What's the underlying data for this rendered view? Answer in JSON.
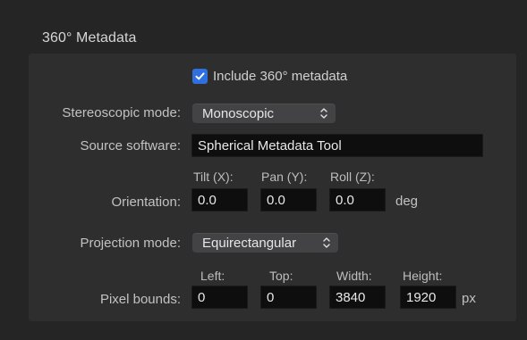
{
  "section": {
    "title": "360° Metadata"
  },
  "include_metadata": {
    "label": "Include 360° metadata",
    "checked": true,
    "color": "#2f6fe0"
  },
  "stereoscopic": {
    "label": "Stereoscopic mode:",
    "value": "Monoscopic"
  },
  "source_software": {
    "label": "Source software:",
    "value": "Spherical Metadata Tool"
  },
  "orientation": {
    "label": "Orientation:",
    "unit": "deg",
    "tilt": {
      "label": "Tilt (X):",
      "value": "0.0"
    },
    "pan": {
      "label": "Pan (Y):",
      "value": "0.0"
    },
    "roll": {
      "label": "Roll (Z):",
      "value": "0.0"
    }
  },
  "projection": {
    "label": "Projection mode:",
    "value": "Equirectangular"
  },
  "pixel_bounds": {
    "label": "Pixel bounds:",
    "unit": "px",
    "left": {
      "label": "Left:",
      "value": "0"
    },
    "top": {
      "label": "Top:",
      "value": "0"
    },
    "width": {
      "label": "Width:",
      "value": "3840"
    },
    "height": {
      "label": "Height:",
      "value": "1920"
    }
  }
}
